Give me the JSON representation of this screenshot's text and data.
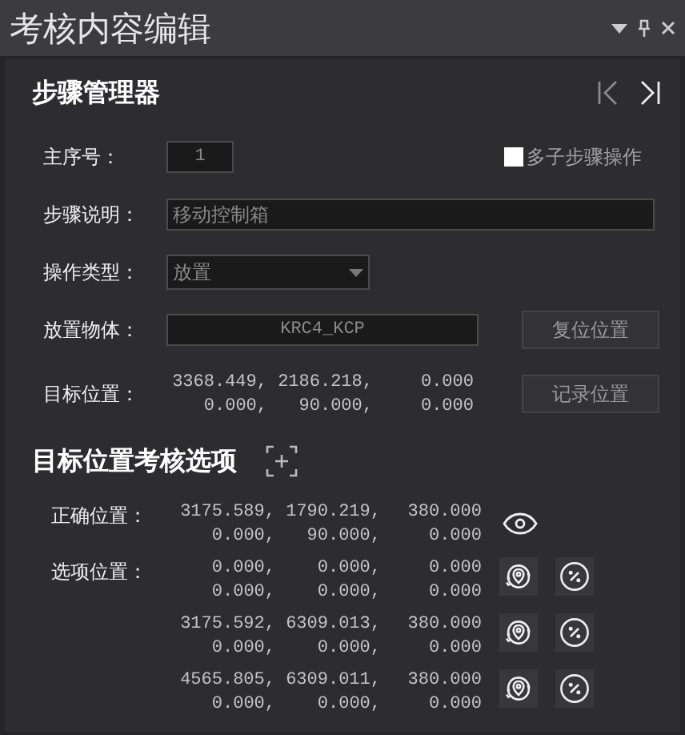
{
  "window": {
    "title": "考核内容编辑"
  },
  "step_manager": {
    "title": "步骤管理器",
    "main_index": {
      "label": "主序号：",
      "value": "1"
    },
    "multi_substep": {
      "label": "多子步骤操作",
      "checked": false
    },
    "description": {
      "label": "步骤说明：",
      "value": "移动控制箱"
    },
    "operation_type": {
      "label": "操作类型：",
      "value": "放置"
    },
    "placed_object": {
      "label": "放置物体：",
      "value": "KRC4_KCP"
    },
    "reset_button": "复位位置",
    "target_position": {
      "label": "目标位置：",
      "values": [
        "3368.449,",
        "2186.218,",
        "0.000",
        "0.000,",
        "90.000,",
        "0.000"
      ]
    },
    "record_button": "记录位置"
  },
  "assessment": {
    "title": "目标位置考核选项",
    "correct": {
      "label": "正确位置：",
      "values": [
        "3175.589,",
        "1790.219,",
        "380.000",
        "0.000,",
        "90.000,",
        "0.000"
      ]
    },
    "options_label": "选项位置：",
    "options": [
      {
        "values": [
          "0.000,",
          "0.000,",
          "0.000",
          "0.000,",
          "0.000,",
          "0.000"
        ]
      },
      {
        "values": [
          "3175.592,",
          "6309.013,",
          "380.000",
          "0.000,",
          "0.000,",
          "0.000"
        ]
      },
      {
        "values": [
          "4565.805,",
          "6309.011,",
          "380.000",
          "0.000,",
          "0.000,",
          "0.000"
        ]
      }
    ]
  }
}
